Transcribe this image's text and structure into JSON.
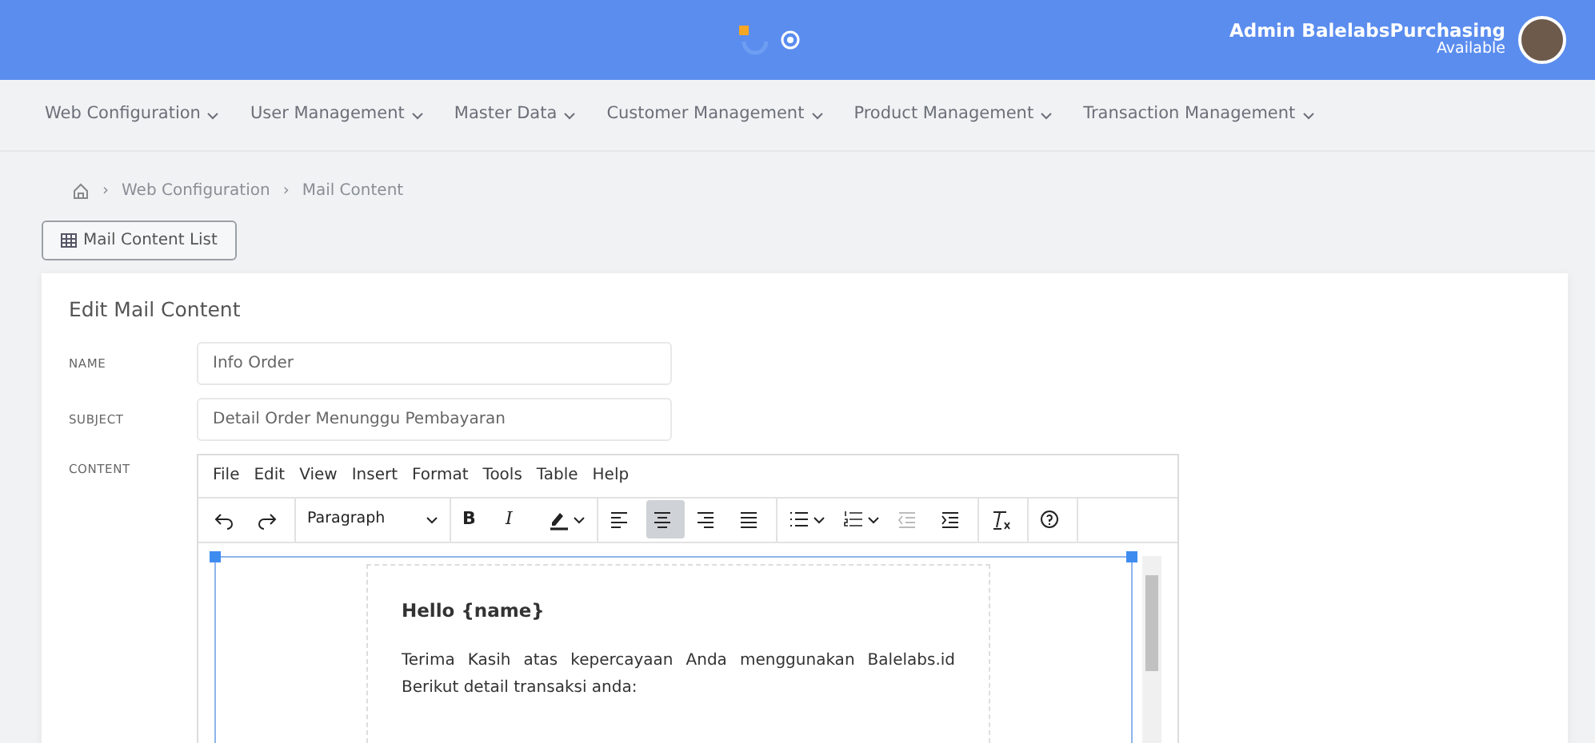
{
  "header": {
    "user_name": "Admin BalelabsPurchasing",
    "user_status": "Available"
  },
  "nav": [
    {
      "label": "Web Configuration"
    },
    {
      "label": "User Management"
    },
    {
      "label": "Master Data"
    },
    {
      "label": "Customer Management"
    },
    {
      "label": "Product Management"
    },
    {
      "label": "Transaction Management"
    }
  ],
  "breadcrumb": [
    "Web Configuration",
    "Mail Content"
  ],
  "breadcrumb_separator": "›",
  "list_button": "Mail Content List",
  "form": {
    "title": "Edit Mail Content",
    "fields": [
      {
        "label": "NAME",
        "value": "Info Order"
      },
      {
        "label": "SUBJECT",
        "value": "Detail Order Menunggu Pembayaran"
      }
    ],
    "content_label": "CONTENT",
    "editor": {
      "menu": [
        "File",
        "Edit",
        "View",
        "Insert",
        "Format",
        "Tools",
        "Table",
        "Help"
      ],
      "toolbar": [
        [
          {
            "kind": "undo",
            "selected": false,
            "disabled": false
          },
          {
            "kind": "redo",
            "selected": false,
            "disabled": false
          }
        ],
        [
          {
            "kind": "select",
            "label": "Paragraph",
            "selected": false,
            "disabled": false
          }
        ],
        [
          {
            "kind": "text",
            "label": "B",
            "selected": false,
            "disabled": false
          },
          {
            "kind": "text",
            "label": "I",
            "selected": false,
            "disabled": false
          },
          {
            "kind": "highlight",
            "selected": false,
            "disabled": false
          }
        ],
        [
          {
            "kind": "align-left",
            "selected": false,
            "disabled": false
          },
          {
            "kind": "align-center",
            "selected": true,
            "disabled": false
          },
          {
            "kind": "align-right",
            "selected": false,
            "disabled": false
          },
          {
            "kind": "justify",
            "selected": false,
            "disabled": false
          }
        ],
        [
          {
            "kind": "bullets",
            "selected": false,
            "disabled": false
          },
          {
            "kind": "numbers",
            "selected": false,
            "disabled": false
          },
          {
            "kind": "outdent",
            "selected": false,
            "disabled": true
          },
          {
            "kind": "indent",
            "selected": false,
            "disabled": false
          }
        ],
        [
          {
            "kind": "clear",
            "selected": false,
            "disabled": false
          }
        ],
        [
          {
            "kind": "help",
            "selected": false,
            "disabled": false
          }
        ]
      ],
      "heading": "Hello {name}",
      "paragraph": "Terima Kasih atas kepercayaan Anda menggunakan Balelabs.id Berikut detail transaksi anda:"
    }
  }
}
